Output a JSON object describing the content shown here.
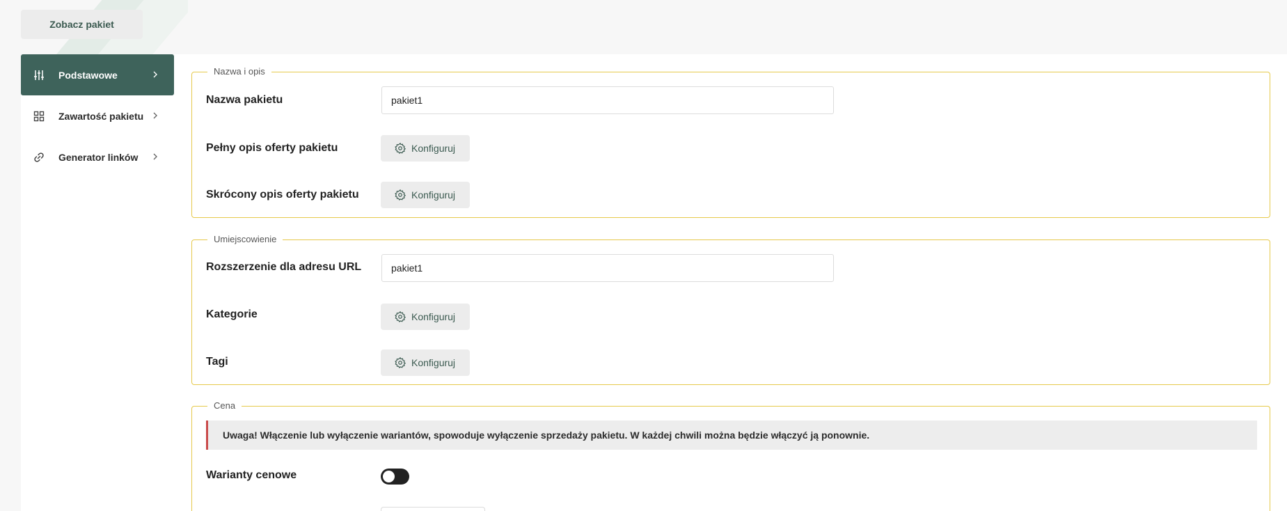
{
  "top_bar": {
    "view_package_label": "Zobacz pakiet"
  },
  "sidebar": {
    "items": [
      {
        "label": "Podstawowe",
        "icon": "sliders-icon",
        "active": true
      },
      {
        "label": "Zawartość pakietu",
        "icon": "grid-icon",
        "active": false
      },
      {
        "label": "Generator linków",
        "icon": "link-icon",
        "active": false
      }
    ]
  },
  "sections": {
    "name_desc": {
      "legend": "Nazwa i opis",
      "name_label": "Nazwa pakietu",
      "name_value": "pakiet1",
      "full_desc_label": "Pełny opis oferty pakietu",
      "short_desc_label": "Skrócony opis oferty pakietu",
      "configure_label": "Konfiguruj"
    },
    "placement": {
      "legend": "Umiejscowienie",
      "url_label": "Rozszerzenie dla adresu URL",
      "url_value": "pakiet1",
      "categories_label": "Kategorie",
      "tags_label": "Tagi",
      "configure_label": "Konfiguruj"
    },
    "price": {
      "legend": "Cena",
      "alert_text": "Uwaga! Włączenie lub wyłączenie wariantów, spowoduje wyłączenie sprzedaży pakietu. W każdej chwili można będzie włączyć ją ponownie.",
      "variants_label": "Warianty cenowe",
      "variants_enabled": false
    }
  },
  "colors": {
    "accent": "#3e635b",
    "fieldset_border": "#e6c94a",
    "alert_border": "#c94a4a",
    "button_bg": "#ececec"
  }
}
